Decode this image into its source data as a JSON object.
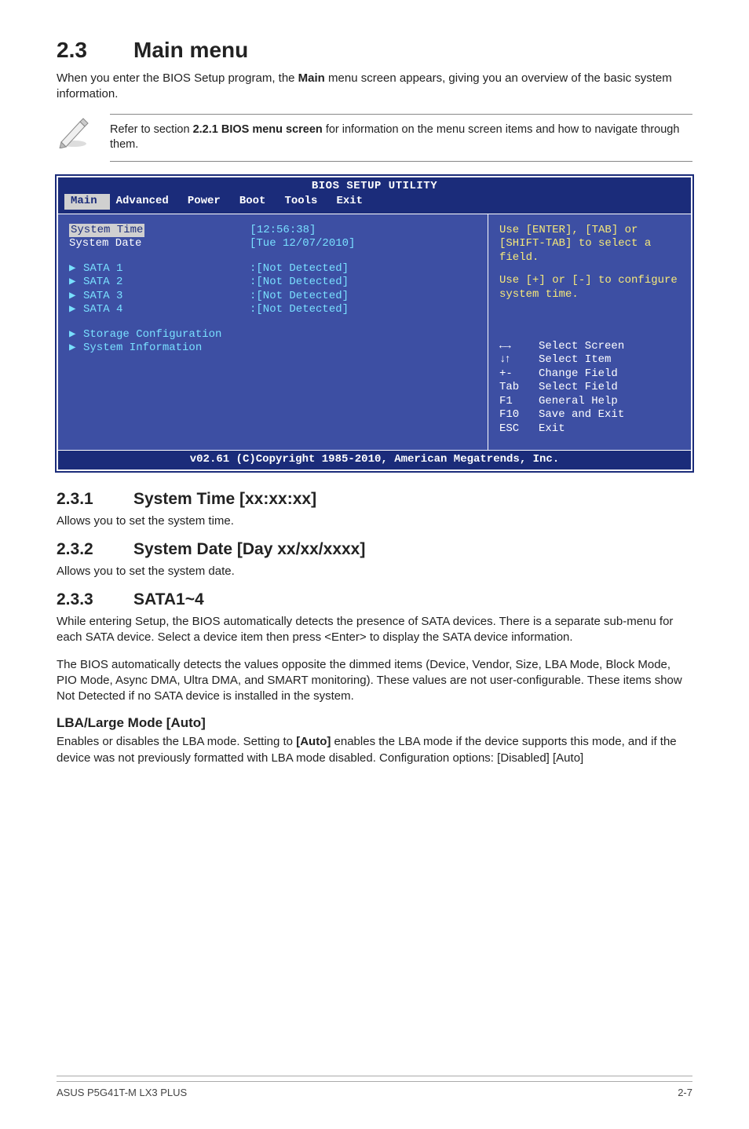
{
  "section": {
    "num": "2.3",
    "title": "Main menu",
    "intro_a": "When you enter the BIOS Setup program, the ",
    "intro_bold": "Main",
    "intro_b": " menu screen appears, giving you an overview of the basic system information."
  },
  "note": {
    "pre": "Refer to section ",
    "bold": "2.2.1 BIOS menu screen",
    "post": " for information on the menu screen items and how to navigate through them."
  },
  "bios": {
    "title": "BIOS SETUP UTILITY",
    "tabs": [
      "Main",
      "Advanced",
      "Power",
      "Boot",
      "Tools",
      "Exit"
    ],
    "left": {
      "system_time_label": "System Time",
      "system_time_value": "[12:56:38]",
      "system_date_label": "System Date",
      "system_date_value": "[Tue 12/07/2010]",
      "sata": [
        {
          "label": "SATA 1",
          "value": ":[Not Detected]"
        },
        {
          "label": "SATA 2",
          "value": ":[Not Detected]"
        },
        {
          "label": "SATA 3",
          "value": ":[Not Detected]"
        },
        {
          "label": "SATA 4",
          "value": ":[Not Detected]"
        }
      ],
      "storage_conf": "Storage Configuration",
      "sys_info": "System Information"
    },
    "right": {
      "help1": "Use [ENTER], [TAB] or [SHIFT-TAB] to select a field.",
      "help2": "Use [+] or [-] to configure system time.",
      "nav": [
        {
          "key": "←→",
          "text": "Select Screen"
        },
        {
          "key": "↓↑",
          "text": "Select Item"
        },
        {
          "key": "+-",
          "text": "Change Field"
        },
        {
          "key": "Tab",
          "text": "Select Field"
        },
        {
          "key": "F1",
          "text": "General Help"
        },
        {
          "key": "F10",
          "text": "Save and Exit"
        },
        {
          "key": "ESC",
          "text": "Exit"
        }
      ]
    },
    "footer": "v02.61 (C)Copyright 1985-2010, American Megatrends, Inc."
  },
  "s231": {
    "num": "2.3.1",
    "title": "System Time [xx:xx:xx]",
    "body": "Allows you to set the system time."
  },
  "s232": {
    "num": "2.3.2",
    "title": "System Date [Day xx/xx/xxxx]",
    "body": "Allows you to set the system date."
  },
  "s233": {
    "num": "2.3.3",
    "title": "SATA1~4",
    "p1": "While entering Setup, the BIOS automatically detects the presence of SATA devices. There is a separate sub-menu for each SATA device. Select a device item then press <Enter> to display the SATA device information.",
    "p2": "The BIOS automatically detects the values opposite the dimmed items (Device, Vendor, Size, LBA Mode, Block Mode, PIO Mode, Async DMA, Ultra DMA, and SMART monitoring). These values are not user-configurable. These items show Not Detected if no SATA device is installed in the system."
  },
  "lba": {
    "title": "LBA/Large Mode [Auto]",
    "p_a": "Enables or disables the LBA mode. Setting to ",
    "p_bold": "[Auto]",
    "p_b": " enables the LBA mode if the device supports this mode, and if the device was not previously formatted with LBA mode disabled. Configuration options: [Disabled] [Auto]"
  },
  "footer": {
    "left": "ASUS P5G41T-M LX3 PLUS",
    "right": "2-7"
  }
}
